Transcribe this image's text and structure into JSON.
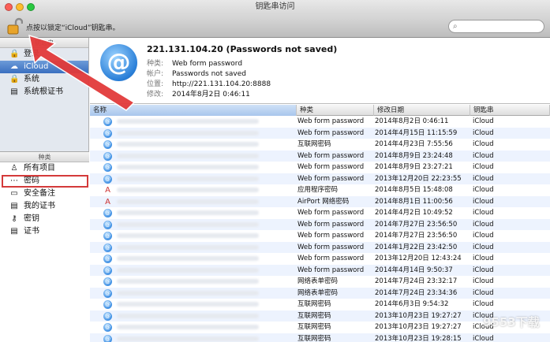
{
  "window": {
    "title": "钥匙串访问"
  },
  "toolbar": {
    "lock_hint": "点按以锁定“iCloud”钥匙串。",
    "search_placeholder": ""
  },
  "sidebar": {
    "keychains_header": "钥匙串",
    "keychains": [
      {
        "label": "登录",
        "icon": "lock-icon"
      },
      {
        "label": "iCloud",
        "icon": "cloud-icon",
        "selected": true
      },
      {
        "label": "系统",
        "icon": "lock-icon"
      },
      {
        "label": "系统根证书",
        "icon": "certificate-icon"
      }
    ],
    "category_header": "种类",
    "categories": [
      {
        "label": "所有项目",
        "icon": "person-icon"
      },
      {
        "label": "密码",
        "icon": "dots-icon",
        "highlighted": true
      },
      {
        "label": "安全备注",
        "icon": "note-icon"
      },
      {
        "label": "我的证书",
        "icon": "certificate-icon"
      },
      {
        "label": "密钥",
        "icon": "key-icon"
      },
      {
        "label": "证书",
        "icon": "certificate-icon"
      }
    ]
  },
  "detail": {
    "title": "221.131.104.20 (Passwords not saved)",
    "rows": [
      {
        "key": "种类:",
        "value": "Web form password"
      },
      {
        "key": "帐户:",
        "value": "Passwords not saved"
      },
      {
        "key": "位置:",
        "value": "http://221.131.104.20:8888"
      },
      {
        "key": "修改:",
        "value": "2014年8月2日 0:46:11"
      }
    ]
  },
  "table": {
    "columns": [
      "名称",
      "种类",
      "修改日期",
      "钥匙串"
    ],
    "rows": [
      {
        "icon": "at-icon",
        "kind": "Web form password",
        "date": "2014年8月2日 0:46:11",
        "keychain": "iCloud"
      },
      {
        "icon": "at-icon",
        "kind": "Web form password",
        "date": "2014年4月15日 11:15:59",
        "keychain": "iCloud"
      },
      {
        "icon": "at-icon",
        "kind": "互联网密码",
        "date": "2014年4月23日 7:55:56",
        "keychain": "iCloud"
      },
      {
        "icon": "at-icon",
        "kind": "Web form password",
        "date": "2014年8月9日 23:24:48",
        "keychain": "iCloud"
      },
      {
        "icon": "at-icon",
        "kind": "Web form password",
        "date": "2014年8月9日 23:27:21",
        "keychain": "iCloud"
      },
      {
        "icon": "at-icon",
        "kind": "Web form password",
        "date": "2013年12月20日 22:23:55",
        "keychain": "iCloud"
      },
      {
        "icon": "app-icon",
        "kind": "应用程序密码",
        "date": "2014年8月5日 15:48:08",
        "keychain": "iCloud"
      },
      {
        "icon": "app-icon",
        "kind": "AirPort 网络密码",
        "date": "2014年8月1日 11:00:56",
        "keychain": "iCloud"
      },
      {
        "icon": "at-icon",
        "kind": "Web form password",
        "date": "2014年4月2日 10:49:52",
        "keychain": "iCloud"
      },
      {
        "icon": "at-icon",
        "kind": "Web form password",
        "date": "2014年7月27日 23:56:50",
        "keychain": "iCloud"
      },
      {
        "icon": "at-icon",
        "kind": "Web form password",
        "date": "2014年7月27日 23:56:50",
        "keychain": "iCloud"
      },
      {
        "icon": "at-icon",
        "kind": "Web form password",
        "date": "2014年1月22日 23:42:50",
        "keychain": "iCloud"
      },
      {
        "icon": "at-icon",
        "kind": "Web form password",
        "date": "2013年12月20日 12:43:24",
        "keychain": "iCloud"
      },
      {
        "icon": "at-icon",
        "kind": "Web form password",
        "date": "2014年4月14日 9:50:37",
        "keychain": "iCloud"
      },
      {
        "icon": "at-icon",
        "kind": "网络表单密码",
        "date": "2014年7月24日 23:32:17",
        "keychain": "iCloud"
      },
      {
        "icon": "at-icon",
        "kind": "网络表单密码",
        "date": "2014年7月24日 23:34:36",
        "keychain": "iCloud"
      },
      {
        "icon": "at-icon",
        "kind": "互联网密码",
        "date": "2014年6月3日 9:54:32",
        "keychain": "iCloud"
      },
      {
        "icon": "at-icon",
        "kind": "互联网密码",
        "date": "2013年10月23日 19:27:27",
        "keychain": "iCloud"
      },
      {
        "icon": "at-icon",
        "kind": "互联网密码",
        "date": "2013年10月23日 19:27:27",
        "keychain": "iCloud"
      },
      {
        "icon": "at-icon",
        "kind": "互联网密码",
        "date": "2013年10月23日 19:28:15",
        "keychain": "iCloud"
      }
    ]
  },
  "watermark": "9553下载"
}
